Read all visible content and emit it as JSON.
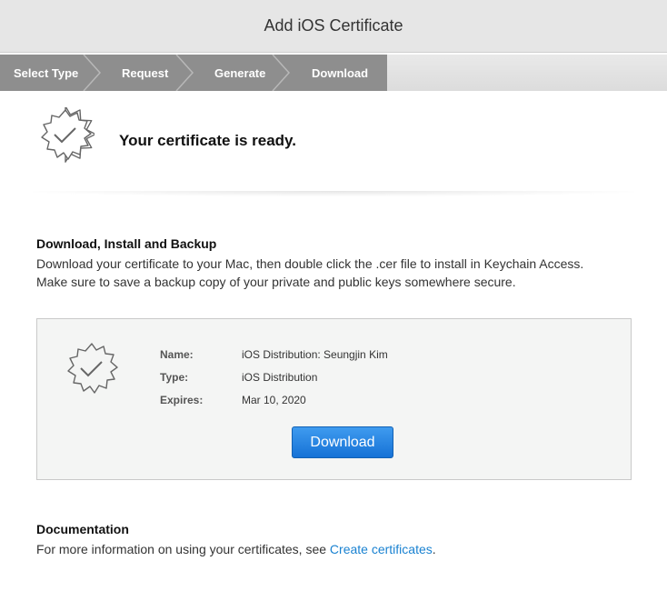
{
  "header": {
    "title": "Add iOS Certificate"
  },
  "steps": [
    {
      "label": "Select Type"
    },
    {
      "label": "Request"
    },
    {
      "label": "Generate"
    },
    {
      "label": "Download"
    }
  ],
  "status": {
    "title": "Your certificate is ready.",
    "icon": "certificate-badge-icon"
  },
  "install": {
    "title": "Download, Install and Backup",
    "line1": "Download your certificate to your Mac, then double click the .cer file to install in Keychain Access.",
    "line2": "Make sure to save a backup copy of your private and public keys somewhere secure."
  },
  "certificate": {
    "icon": "certificate-badge-icon",
    "name_label": "Name:",
    "name_value": "iOS Distribution: Seungjin Kim",
    "type_label": "Type:",
    "type_value": "iOS Distribution",
    "expires_label": "Expires:",
    "expires_value": "Mar 10, 2020",
    "download_label": "Download"
  },
  "documentation": {
    "title": "Documentation",
    "text": "For more information on using your certificates, see ",
    "link": "Create certificates",
    "trailing": "."
  },
  "colors": {
    "accent": "#1a82d1",
    "button": "#1672d6",
    "steps_bg": "#8e8e8e"
  }
}
